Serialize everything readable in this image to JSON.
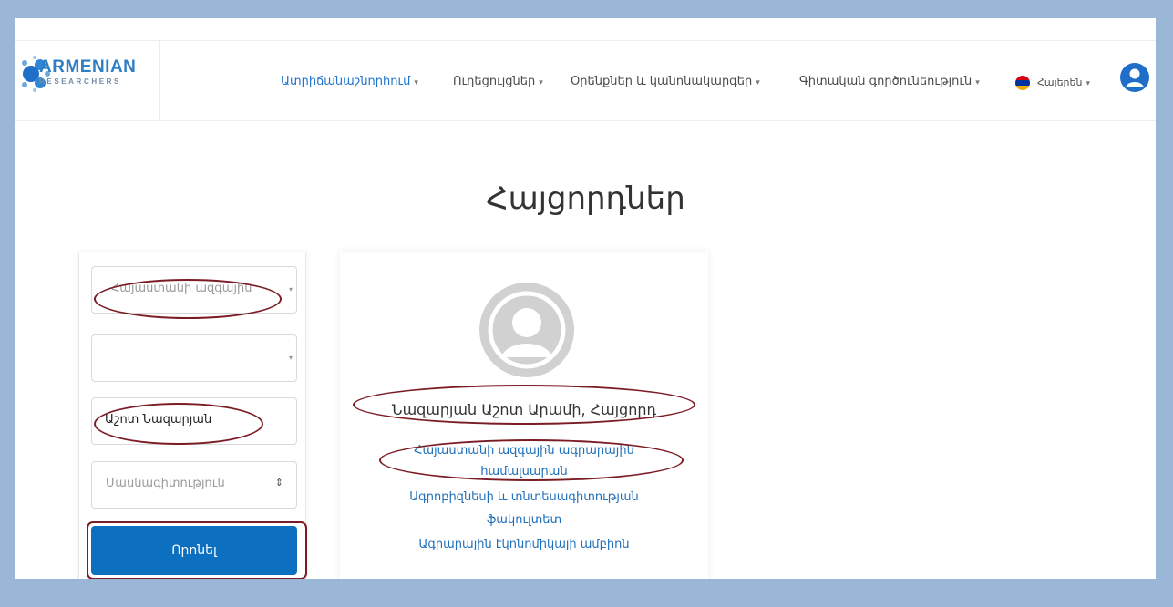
{
  "header": {
    "logo_text": "ARMENIAN",
    "logo_sub": "RESEARCHERS",
    "nav": [
      {
        "label": "Ատրիճանաշնորհում",
        "active": true
      },
      {
        "label": "Ուղեցույցներ"
      },
      {
        "label": "Օրենքներ և կանոնակարգեր"
      },
      {
        "label": "Գիտական գործունեություն"
      }
    ],
    "language": "Հայերեն",
    "caret": "▾"
  },
  "page_title": "Հայցորդներ",
  "filters": {
    "university": {
      "value": "Հայաստանի ազգային"
    },
    "faculty": {
      "value": ""
    },
    "name_input": {
      "value": "Աշոտ Նազարյան"
    },
    "specialty": {
      "placeholder": "Մասնագիտություն"
    },
    "search_label": "Որոնել",
    "dropdown_glyph": "▾",
    "updown_glyph": "⇕"
  },
  "result_card": {
    "name": "Նազարյան Աշոտ Արամի, Հայցորդ",
    "links": [
      "Հայաստանի ազգային ագրարային",
      "համալսարան",
      "Ագրոբիզնեսի և տնտեսագիտության",
      "ֆակուլտետ",
      "Ագրարային էկոնոմիկայի ամբիոն"
    ]
  },
  "colors": {
    "accent": "#0d6fbf",
    "annotation": "#7b1c25",
    "outer_border": "#9bb7d8"
  }
}
